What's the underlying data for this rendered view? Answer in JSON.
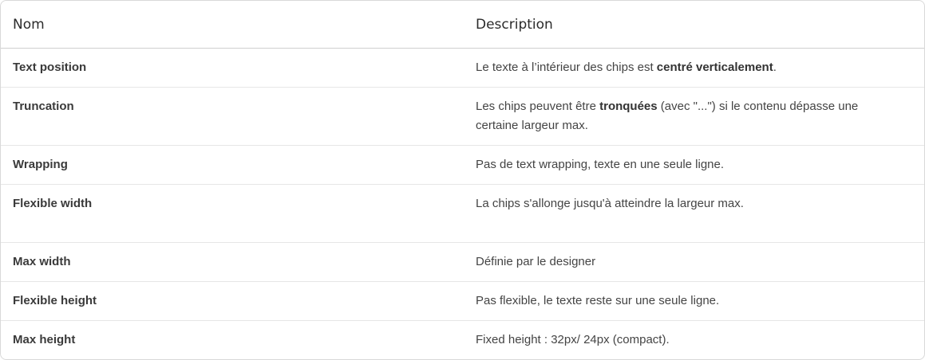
{
  "table": {
    "headers": {
      "name": "Nom",
      "description": "Description"
    },
    "rows": [
      {
        "name": "Text position",
        "desc_before": "Le texte à l’intérieur des chips est ",
        "desc_bold": "centré verticalement",
        "desc_after": "."
      },
      {
        "name": "Truncation",
        "desc_before": "Les chips peuvent être ",
        "desc_bold": "tronquées",
        "desc_after": " (avec \"...\") si le contenu dépasse une certaine largeur max."
      },
      {
        "name": "Wrapping",
        "desc": "Pas de text wrapping, texte en une seule ligne."
      },
      {
        "name": "Flexible width",
        "desc": "La chips s'allonge jusqu'à atteindre la largeur max."
      },
      {
        "name": "Max width",
        "desc": "Définie par le designer"
      },
      {
        "name": "Flexible height",
        "desc": "Pas flexible, le texte reste sur une seule ligne."
      },
      {
        "name": "Max height",
        "desc": "Fixed height : 32px/ 24px (compact)."
      }
    ]
  }
}
